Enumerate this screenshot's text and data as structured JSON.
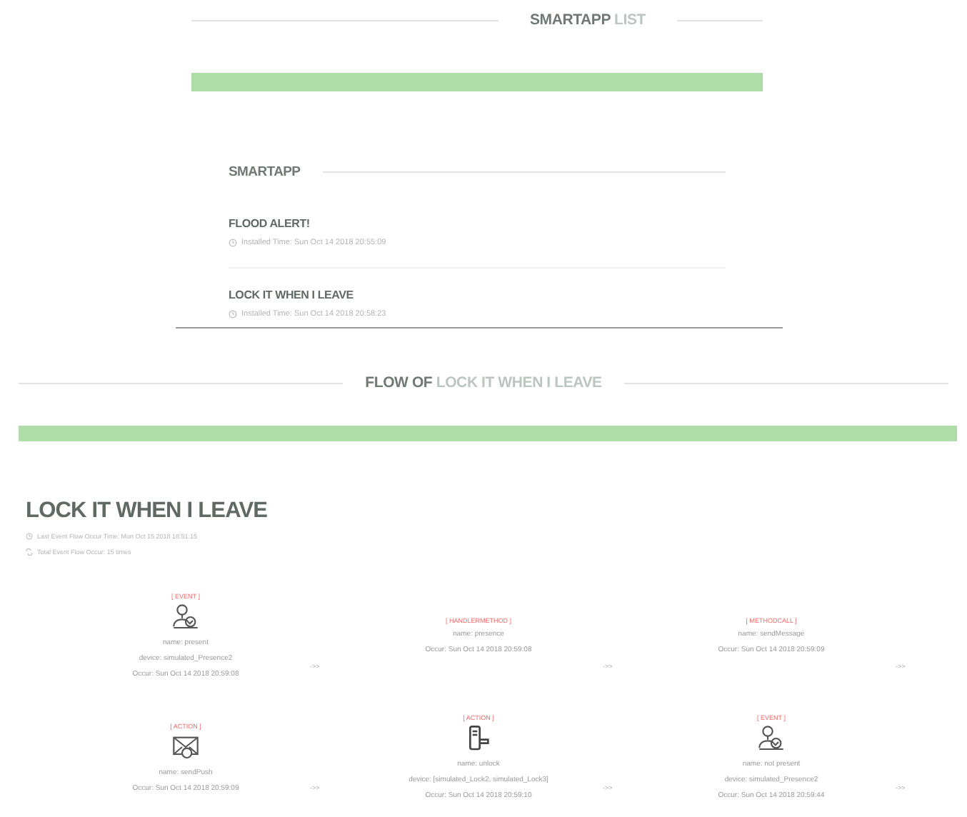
{
  "list_section": {
    "title_lead": "SMARTAPP",
    "title_accent": "LIST",
    "heading": "SMARTAPP",
    "items": [
      {
        "name": "FLOOD ALERT!",
        "installed": "Installed Time: Sun Oct 14 2018 20:55:09"
      },
      {
        "name": "LOCK IT WHEN I LEAVE",
        "installed": "Installed Time: Sun Oct 14 2018 20:58:23"
      }
    ]
  },
  "flow_section": {
    "title_lead": "FLOW OF",
    "title_accent": "LOCK IT WHEN I LEAVE",
    "heading": "LOCK IT WHEN I LEAVE",
    "last_occur": "Last Event Flow Occur Time: Mon Oct 15 2018 18:51:15",
    "total_occur": "Total Event Flow Occur: 15 times",
    "steps": [
      {
        "kind": "presence",
        "label": "[ EVENT ]",
        "lines": [
          "name: present",
          "device: simulated_Presence2",
          "Occur: Sun Oct 14 2018 20:59:08"
        ],
        "arrow": "->>"
      },
      {
        "kind": "plain",
        "label": "[ HANDLERMETHOD ]",
        "lines": [
          "name: presence",
          "Occur: Sun Oct 14 2018 20:59:08"
        ],
        "arrow": "->>"
      },
      {
        "kind": "plain",
        "label": "[ METHODCALL ]",
        "lines": [
          "name: sendMessage",
          "Occur: Sun Oct 14 2018 20:59:09"
        ],
        "arrow": "->>"
      },
      {
        "kind": "message",
        "label": "[ ACTION ]",
        "lines": [
          "name: sendPush",
          "Occur: Sun Oct 14 2018 20:59:09"
        ],
        "arrow": "->>"
      },
      {
        "kind": "lock",
        "label": "[ ACTION ]",
        "lines": [
          "name: unlock",
          "device: [simulated_Lock2, simulated_Lock3]",
          "Occur: Sun Oct 14 2018 20:59:10"
        ],
        "arrow": "->>"
      },
      {
        "kind": "presence",
        "label": "[ EVENT ]",
        "lines": [
          "name: not present",
          "device: simulated_Presence2",
          "Occur: Sun Oct 14 2018 20:59:44"
        ],
        "arrow": "->>"
      }
    ]
  }
}
